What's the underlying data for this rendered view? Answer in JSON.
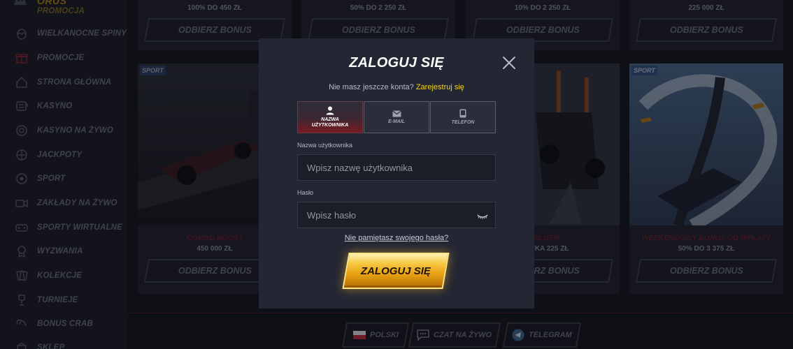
{
  "brand": {
    "name": "ORUS"
  },
  "sidebar": {
    "items": [
      {
        "label": "PROMOCJA",
        "icon": "crown-icon"
      },
      {
        "label": "WIELKANOCNE SPINY",
        "icon": "egg-icon"
      },
      {
        "label": "PROMOCJE",
        "icon": "gift-icon"
      },
      {
        "label": "STRONA GŁÓWNA",
        "icon": "home-icon"
      },
      {
        "label": "KASYNO",
        "icon": "slot-icon"
      },
      {
        "label": "KASYNO NA ŻYWO",
        "icon": "chip-icon"
      },
      {
        "label": "JACKPOTY",
        "icon": "target-icon"
      },
      {
        "label": "SPORT",
        "icon": "ball-icon"
      },
      {
        "label": "ZAKŁADY NA ŻYWO",
        "icon": "video-icon"
      },
      {
        "label": "SPORTY WIRTUALNE",
        "icon": "gamepad-icon"
      },
      {
        "label": "WYZWANIA",
        "icon": "medal-icon"
      },
      {
        "label": "KOLEKCJE",
        "icon": "cards-icon"
      },
      {
        "label": "TURNIEJE",
        "icon": "trophy-icon"
      },
      {
        "label": "BONUS CRAB",
        "icon": "claw-icon"
      },
      {
        "label": "SKLEP",
        "icon": "bag-icon"
      }
    ]
  },
  "promos_top": [
    {
      "amount": "100% DO 450 ZŁ",
      "button": "ODBIERZ BONUS"
    },
    {
      "amount": "50% DO 2 250 ZŁ",
      "button": "ODBIERZ BONUS"
    },
    {
      "amount": "10% DO 2 250 ZŁ",
      "button": "ODBIERZ BONUS"
    },
    {
      "amount": "225 000 ZŁ",
      "button": "ODBIERZ BONUS"
    }
  ],
  "promos_bottom": [
    {
      "tag": "SPORT",
      "title": "COMBO BOOST",
      "sub": "450 000 ZŁ",
      "button": "ODBIERZ BONUS"
    },
    {
      "tag": "",
      "title": "",
      "sub": "",
      "button": ""
    },
    {
      "tag": "",
      "title": "BUILDER",
      "sub": "RYZYKA 225 ZŁ",
      "button": "ODBIERZ BONUS"
    },
    {
      "tag": "SPORT",
      "title": "WEEKENDOWY BONUS OD WPŁATY",
      "sub": "50% DO 3 375 ZŁ",
      "button": "ODBIERZ BONUS"
    }
  ],
  "footer": {
    "language": "POLSKI",
    "chat": "CZAT NA ŻYWO",
    "telegram": "TELEGRAM"
  },
  "modal": {
    "title": "ZALOGUJ SIĘ",
    "no_account": "Nie masz jeszcze konta?",
    "register": "Zarejestruj się",
    "tabs": [
      {
        "label_line1": "NAZWA",
        "label_line2": "UŻYTKOWNIKA",
        "active": true
      },
      {
        "label_line1": "E-MAIL",
        "label_line2": "",
        "active": false
      },
      {
        "label_line1": "TELEFON",
        "label_line2": "",
        "active": false
      }
    ],
    "username": {
      "label": "Nazwa użytkownika",
      "placeholder": "Wpisz nazwę użytkownika",
      "value": ""
    },
    "password": {
      "label": "Hasło",
      "placeholder": "Wpisz hasło",
      "value": ""
    },
    "forgot": "Nie pamiętasz swojego hasła?",
    "submit": "ZALOGUJ SIĘ"
  },
  "colors": {
    "accent": "#f3d21b",
    "active_tab": "#7a1b22",
    "gold": "#f7c842"
  }
}
